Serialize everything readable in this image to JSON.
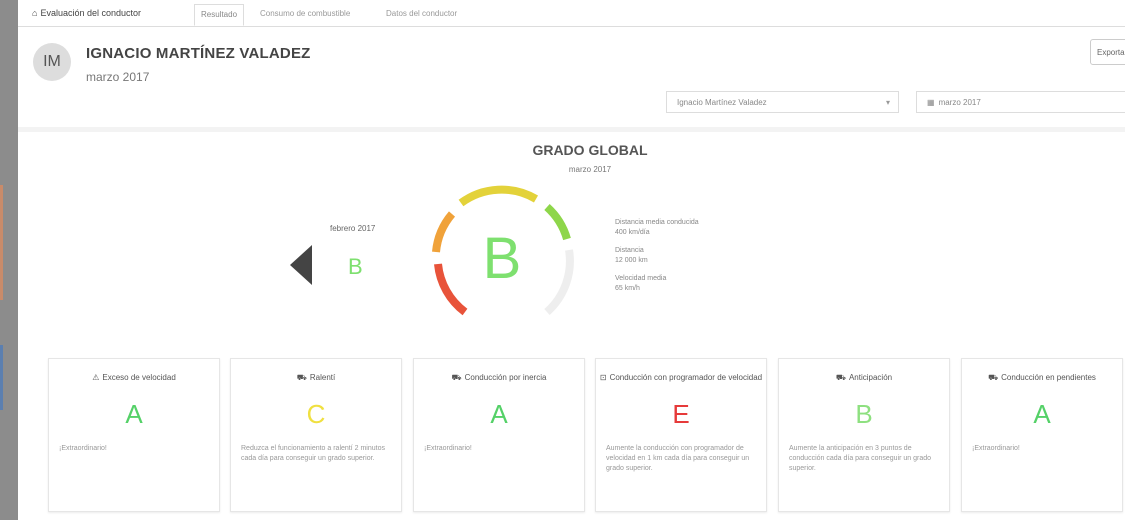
{
  "nav": {
    "brand": "Evaluación del conductor",
    "tabs": [
      "Resultado",
      "Consumo de combustible",
      "Datos del conductor"
    ]
  },
  "header": {
    "avatar_initials": "IM",
    "driver_name": "IGNACIO MARTÍNEZ VALADEZ",
    "month": "marzo 2017",
    "export_label": "Exportar",
    "driver_select_value": "Ignacio Martínez Valadez",
    "date_value": "marzo 2017"
  },
  "global": {
    "title": "GRADO GLOBAL",
    "month": "marzo 2017",
    "grade": "B",
    "prev_month": "febrero 2017",
    "prev_grade": "B",
    "stats": [
      {
        "label": "Distancia media conducida",
        "value": "400 km/día"
      },
      {
        "label": "Distancia",
        "value": "12 000 km"
      },
      {
        "label": "Velocidad media",
        "value": "65 km/h"
      }
    ]
  },
  "cards": [
    {
      "icon": "speedometer-icon",
      "glyph": "⚠",
      "title": "Exceso de velocidad",
      "grade": "A",
      "color": "#55d168",
      "desc": "¡Extraordinario!"
    },
    {
      "icon": "engine-icon",
      "glyph": "⛟",
      "title": "Ralentí",
      "grade": "C",
      "color": "#f0e040",
      "desc": "Reduzca el funcionamiento a ralentí 2 minutos cada día para conseguir un grado superior."
    },
    {
      "icon": "coasting-icon",
      "glyph": "⛟",
      "title": "Conducción por inercia",
      "grade": "A",
      "color": "#55d168",
      "desc": "¡Extraordinario!"
    },
    {
      "icon": "cruise-control-icon",
      "glyph": "⊡",
      "title": "Conducción con programador de velocidad",
      "grade": "E",
      "color": "#e63a3a",
      "desc": "Aumente la conducción con programador de velocidad en 1 km cada día para conseguir un grado superior."
    },
    {
      "icon": "anticipation-icon",
      "glyph": "⛟",
      "title": "Anticipación",
      "grade": "B",
      "color": "#8ee080",
      "desc": "Aumente la anticipación en 3 puntos de conducción cada día para conseguir un grado superior."
    },
    {
      "icon": "slope-icon",
      "glyph": "⛟",
      "title": "Conducción en pendientes",
      "grade": "A",
      "color": "#55d168",
      "desc": "¡Extraordinario!"
    }
  ]
}
